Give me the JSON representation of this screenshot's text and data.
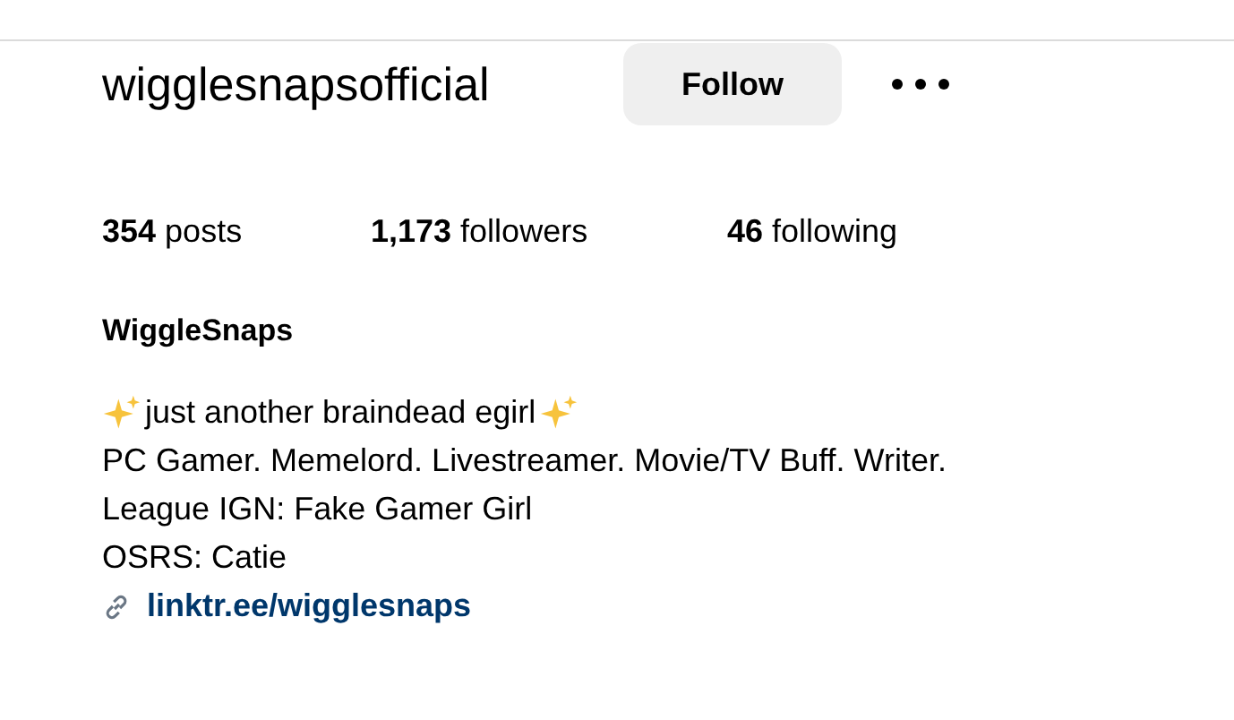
{
  "profile": {
    "username": "wigglesnapsofficial",
    "follow_button": "Follow"
  },
  "stats": [
    "**354** posts",
    "**1,173** followers",
    "**46** following"
  ],
  "display_name": "WiggleSnaps",
  "bio": [
    {
      "kind": "sparkle",
      "text": "just another braindead egirl"
    },
    {
      "kind": "plain",
      "text": "PC Gamer. Memelord. Livestreamer. Movie/TV Buff. Writer."
    },
    {
      "kind": "plain",
      "text": "League IGN: Fake Gamer Girl"
    },
    {
      "kind": "plain",
      "text": "OSRS: Catie"
    }
  ],
  "link": "linktr.ee/wigglesnaps"
}
